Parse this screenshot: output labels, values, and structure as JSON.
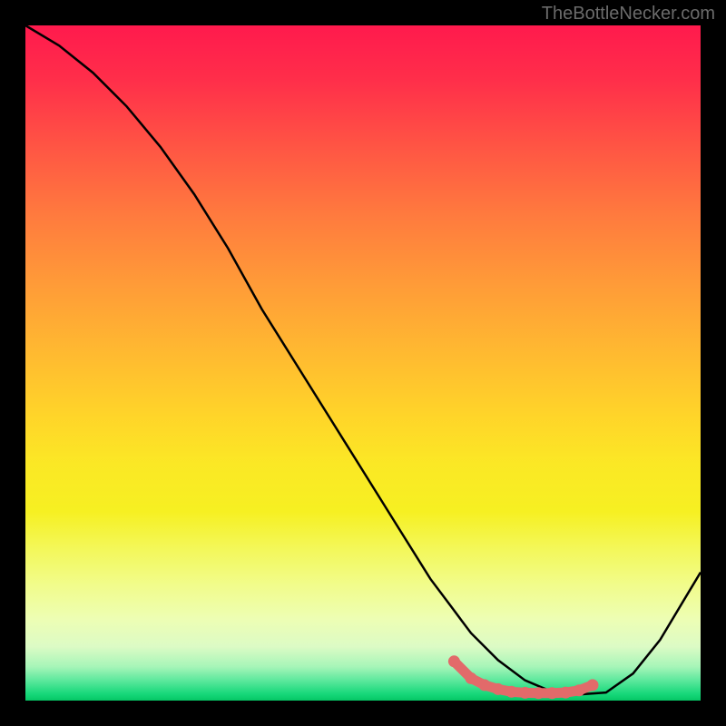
{
  "watermark": "TheBottleNecker.com",
  "chart_data": {
    "type": "line",
    "title": "",
    "xlabel": "",
    "ylabel": "",
    "x_range": [
      0,
      100
    ],
    "y_range": [
      0,
      100
    ],
    "series": [
      {
        "name": "curve",
        "x": [
          0,
          5,
          10,
          15,
          20,
          25,
          30,
          35,
          40,
          45,
          50,
          55,
          60,
          63,
          66,
          70,
          74,
          78,
          82,
          86,
          90,
          94,
          100
        ],
        "y": [
          100,
          97,
          93,
          88,
          82,
          75,
          67,
          58,
          50,
          42,
          34,
          26,
          18,
          14,
          10,
          6,
          3,
          1.3,
          0.9,
          1.2,
          4,
          9,
          19
        ],
        "color": "#000000"
      },
      {
        "name": "highlight",
        "x": [
          63.5,
          66,
          68,
          70,
          72,
          74,
          76,
          78,
          80,
          82,
          84
        ],
        "y": [
          5.8,
          3.3,
          2.3,
          1.7,
          1.3,
          1.15,
          1.1,
          1.1,
          1.2,
          1.5,
          2.3
        ],
        "color": "#e26a6a",
        "style": "thick-dotted"
      }
    ],
    "background_gradient": {
      "top": "#ff1a4d",
      "middle": "#ffd529",
      "bottom": "#05c765"
    }
  }
}
